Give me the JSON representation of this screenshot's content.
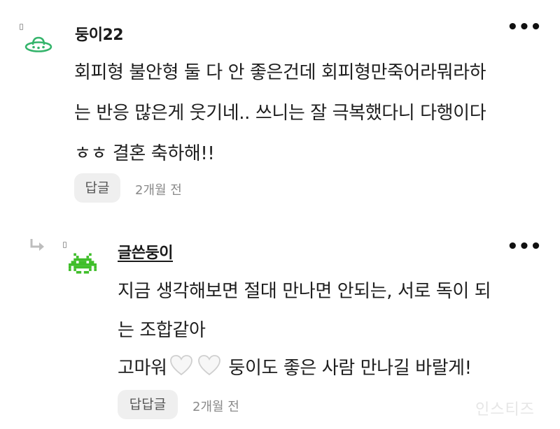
{
  "comment1": {
    "nickname": "둥이22",
    "more_label": "•••",
    "avatar_icon": "ufo-icon",
    "avatar_color": "#34b46b",
    "lines": [
      "회피형 불안형 둘 다 안 좋은건데 회피형만죽어라뭐라하",
      "는 반응 많은게 웃기네.. 쓰니는 잘 극복했다니 다행이다",
      "ㅎㅎ 결혼 축하해!!"
    ],
    "reply_label": "답글",
    "time": "2개월 전"
  },
  "reply1": {
    "nickname": "글쓴둥이",
    "more_label": "•••",
    "avatar_icon": "space-invader-icon",
    "avatar_color": "#3fbe2a",
    "lines": [
      "지금 생각해보면 절대 만나면 안되는, 서로 독이 되",
      "는 조합같아"
    ],
    "line3_before": "고마워",
    "line3_after": " 둥이도 좋은 사람 만나길 바랄게!",
    "reply_label": "답답글",
    "time": "2개월 전"
  },
  "watermark": "인스티즈"
}
